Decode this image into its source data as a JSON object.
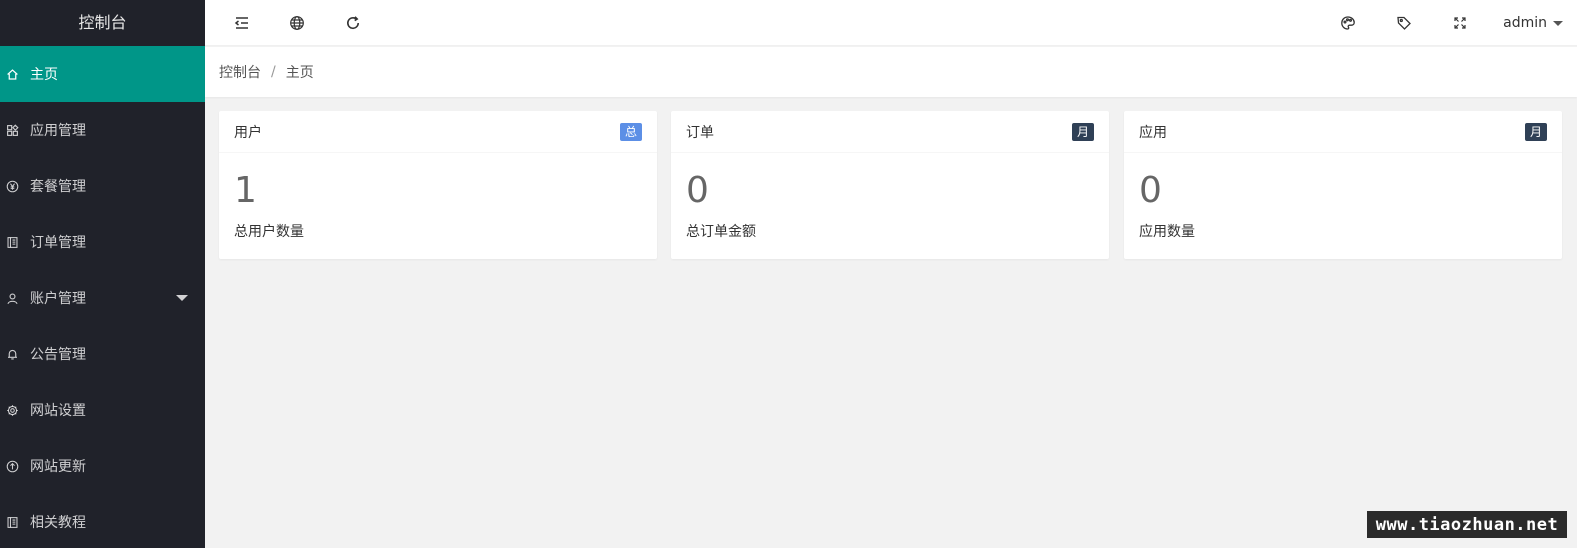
{
  "sidebar": {
    "logo": "控制台",
    "active_color": "#009688",
    "items": [
      {
        "label": "主页",
        "icon": "home-icon",
        "active": true
      },
      {
        "label": "应用管理",
        "icon": "apps-icon"
      },
      {
        "label": "套餐管理",
        "icon": "yen-icon"
      },
      {
        "label": "订单管理",
        "icon": "book-icon"
      },
      {
        "label": "账户管理",
        "icon": "user-icon",
        "has_submenu": true
      },
      {
        "label": "公告管理",
        "icon": "bell-icon"
      },
      {
        "label": "网站设置",
        "icon": "gear-icon"
      },
      {
        "label": "网站更新",
        "icon": "upload-icon"
      },
      {
        "label": "相关教程",
        "icon": "book-icon"
      }
    ]
  },
  "header": {
    "left_icons": [
      "menu-toggle-icon",
      "globe-icon",
      "refresh-icon"
    ],
    "right_icons": [
      "palette-icon",
      "tag-icon",
      "fullscreen-icon"
    ],
    "user": "admin"
  },
  "breadcrumb": {
    "root": "控制台",
    "separator": "/",
    "current": "主页"
  },
  "cards": [
    {
      "title": "用户",
      "badge": "总",
      "badge_color": "#5c8fe6",
      "value": "1",
      "desc": "总用户数量"
    },
    {
      "title": "订单",
      "badge": "月",
      "badge_color": "#2f4056",
      "value": "0",
      "desc": "总订单金额"
    },
    {
      "title": "应用",
      "badge": "月",
      "badge_color": "#2f4056",
      "value": "0",
      "desc": "应用数量"
    }
  ],
  "watermark": "www.tiaozhuan.net"
}
